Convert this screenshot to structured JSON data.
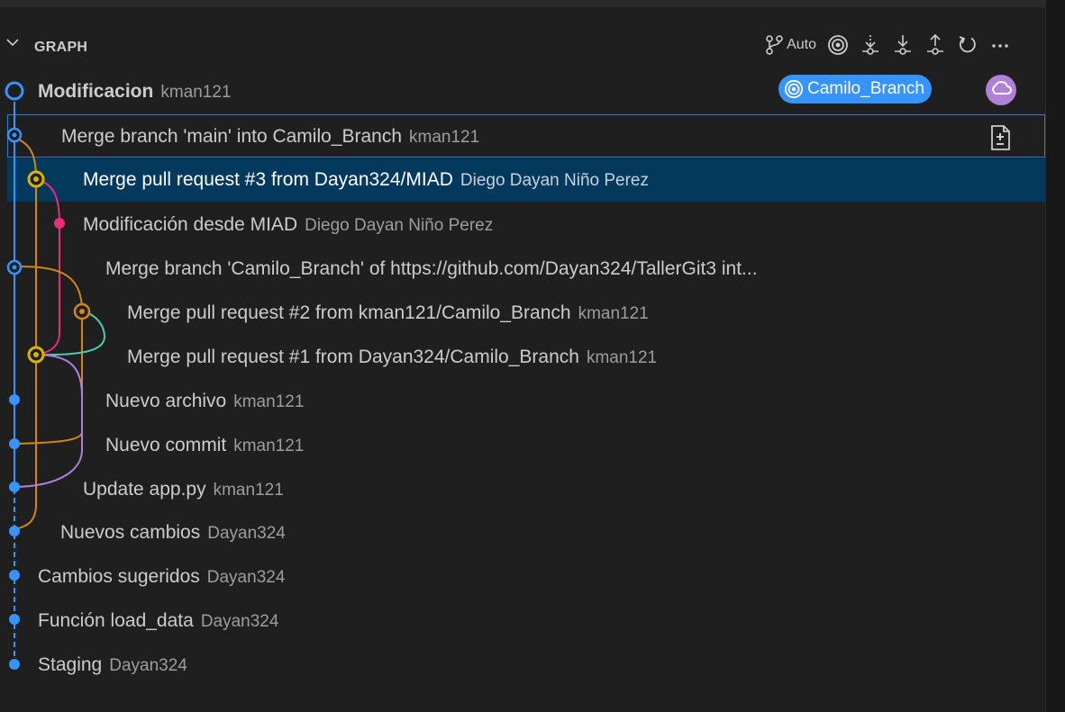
{
  "header": {
    "title": "GRAPH",
    "auto_label": "Auto",
    "icons": [
      "git-branch-icon",
      "target-icon",
      "fetch-icon",
      "pull-icon",
      "push-icon",
      "refresh-icon",
      "more-icon"
    ]
  },
  "badges": {
    "branch": "Camilo_Branch",
    "branch_icon": "target-icon",
    "remote_icon": "cloud-icon",
    "branch_color": "#3794ff",
    "remote_color": "#b180d7"
  },
  "colors": {
    "blue": "#3794ff",
    "orange": "#d18616",
    "pink": "#e62e7a",
    "yellow": "#ddb100",
    "purple": "#b180d7",
    "teal": "#4ec9b0",
    "selection": "#04395e"
  },
  "commits": [
    {
      "message": "Modificacion",
      "author": "kman121"
    },
    {
      "message": "Merge branch 'main' into Camilo_Branch",
      "author": "kman121"
    },
    {
      "message": "Merge pull request #3 from Dayan324/MIAD",
      "author": "Diego Dayan Niño Perez"
    },
    {
      "message": "Modificación desde MIAD",
      "author": "Diego Dayan Niño Perez"
    },
    {
      "message": "Merge branch 'Camilo_Branch' of https://github.com/Dayan324/TallerGit3 int...",
      "author": ""
    },
    {
      "message": "Merge pull request #2 from kman121/Camilo_Branch",
      "author": "kman121"
    },
    {
      "message": "Merge pull request #1 from Dayan324/Camilo_Branch",
      "author": "kman121"
    },
    {
      "message": "Nuevo archivo",
      "author": "kman121"
    },
    {
      "message": "Nuevo commit",
      "author": "kman121"
    },
    {
      "message": "Update app.py",
      "author": "kman121"
    },
    {
      "message": "Nuevos cambios",
      "author": "Dayan324"
    },
    {
      "message": "Cambios sugeridos",
      "author": "Dayan324"
    },
    {
      "message": "Función load_data",
      "author": "Dayan324"
    },
    {
      "message": "Staging",
      "author": "Dayan324"
    }
  ]
}
